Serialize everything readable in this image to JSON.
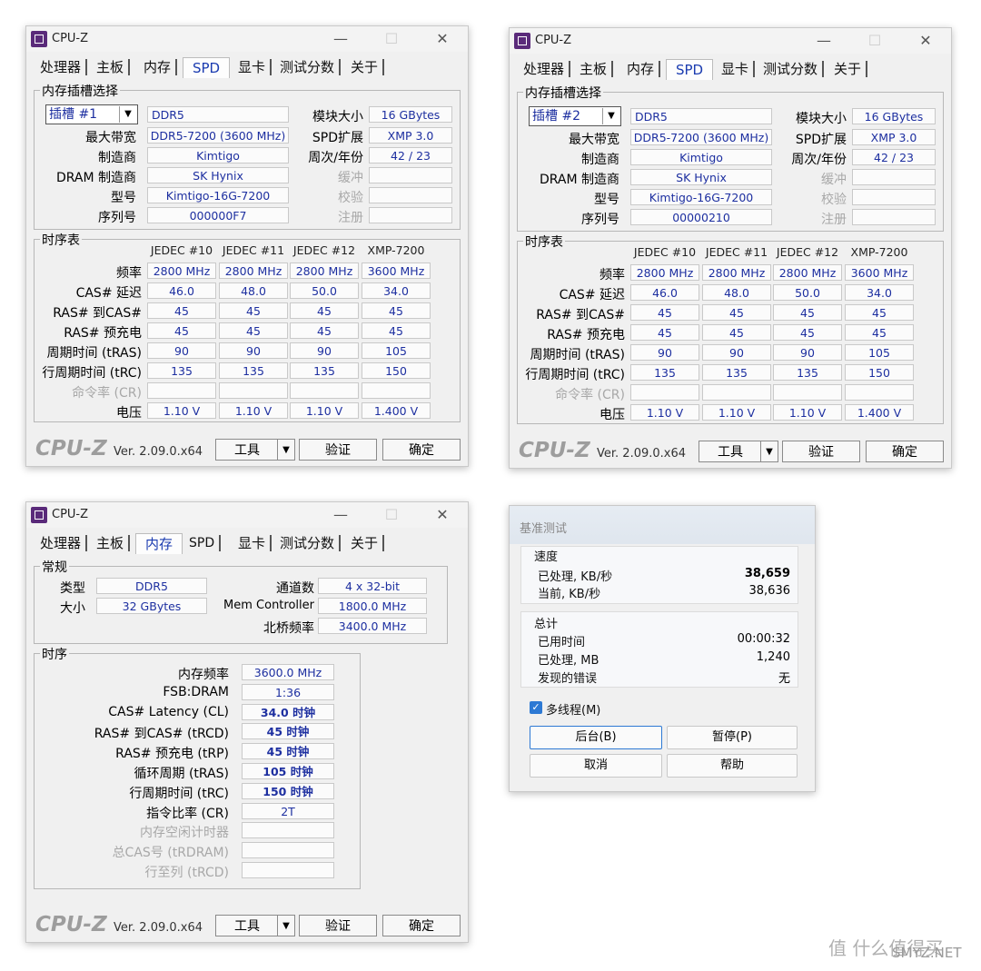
{
  "app_title": "CPU-Z",
  "tabs": [
    "处理器",
    "主板",
    "内存",
    "SPD",
    "显卡",
    "测试分数",
    "关于"
  ],
  "footer": {
    "logo": "CPU-Z",
    "version": "Ver. 2.09.0.x64",
    "tools": "工具",
    "validate": "验证",
    "ok": "确定"
  },
  "spd_labels": {
    "slot_group": "内存插槽选择",
    "max_bw": "最大带宽",
    "manufacturer": "制造商",
    "dram_mfr": "DRAM 制造商",
    "part": "型号",
    "serial": "序列号",
    "module_size": "模块大小",
    "spd_ext": "SPD扩展",
    "week_year": "周次/年份",
    "buffered": "缓冲",
    "corrected": "校验",
    "registered": "注册",
    "timing_group": "时序表",
    "row_labels": [
      "频率",
      "CAS# 延迟",
      "RAS# 到CAS#",
      "RAS# 预充电",
      "周期时间 (tRAS)",
      "行周期时间 (tRC)",
      "命令率 (CR)",
      "电压"
    ]
  },
  "spd_windows": [
    {
      "slot": "插槽 #1",
      "type": "DDR5",
      "max_bw": "DDR5-7200 (3600 MHz)",
      "manufacturer": "Kimtigo",
      "dram_mfr": "SK Hynix",
      "part": "Kimtigo-16G-7200",
      "serial": "000000F7",
      "module_size": "16 GBytes",
      "spd_ext": "XMP 3.0",
      "week_year": "42 / 23",
      "columns": [
        "JEDEC #10",
        "JEDEC #11",
        "JEDEC #12",
        "XMP-7200"
      ],
      "rows": [
        [
          "2800 MHz",
          "2800 MHz",
          "2800 MHz",
          "3600 MHz"
        ],
        [
          "46.0",
          "48.0",
          "50.0",
          "34.0"
        ],
        [
          "45",
          "45",
          "45",
          "45"
        ],
        [
          "45",
          "45",
          "45",
          "45"
        ],
        [
          "90",
          "90",
          "90",
          "105"
        ],
        [
          "135",
          "135",
          "135",
          "150"
        ],
        [
          "",
          "",
          "",
          ""
        ],
        [
          "1.10 V",
          "1.10 V",
          "1.10 V",
          "1.400 V"
        ]
      ]
    },
    {
      "slot": "插槽 #2",
      "type": "DDR5",
      "max_bw": "DDR5-7200 (3600 MHz)",
      "manufacturer": "Kimtigo",
      "dram_mfr": "SK Hynix",
      "part": "Kimtigo-16G-7200",
      "serial": "00000210",
      "module_size": "16 GBytes",
      "spd_ext": "XMP 3.0",
      "week_year": "42 / 23",
      "columns": [
        "JEDEC #10",
        "JEDEC #11",
        "JEDEC #12",
        "XMP-7200"
      ],
      "rows": [
        [
          "2800 MHz",
          "2800 MHz",
          "2800 MHz",
          "3600 MHz"
        ],
        [
          "46.0",
          "48.0",
          "50.0",
          "34.0"
        ],
        [
          "45",
          "45",
          "45",
          "45"
        ],
        [
          "45",
          "45",
          "45",
          "45"
        ],
        [
          "90",
          "90",
          "90",
          "105"
        ],
        [
          "135",
          "135",
          "135",
          "150"
        ],
        [
          "",
          "",
          "",
          ""
        ],
        [
          "1.10 V",
          "1.10 V",
          "1.10 V",
          "1.400 V"
        ]
      ]
    }
  ],
  "memory": {
    "general_group": "常规",
    "type_label": "类型",
    "type": "DDR5",
    "size_label": "大小",
    "size": "32 GBytes",
    "channels_label": "通道数",
    "channels": "4 x 32-bit",
    "mc_label": "Mem Controller",
    "mc": "1800.0 MHz",
    "nb_label": "北桥频率",
    "nb": "3400.0 MHz",
    "timing_group": "时序",
    "timings": [
      {
        "label": "内存频率",
        "value": "3600.0 MHz"
      },
      {
        "label": "FSB:DRAM",
        "value": "1:36"
      },
      {
        "label": "CAS# Latency (CL)",
        "value": "34.0 时钟"
      },
      {
        "label": "RAS# 到CAS# (tRCD)",
        "value": "45 时钟"
      },
      {
        "label": "RAS# 预充电 (tRP)",
        "value": "45 时钟"
      },
      {
        "label": "循环周期 (tRAS)",
        "value": "105 时钟"
      },
      {
        "label": "行周期时间 (tRC)",
        "value": "150 时钟"
      },
      {
        "label": "指令比率 (CR)",
        "value": "2T"
      },
      {
        "label": "内存空闲计时器",
        "value": ""
      },
      {
        "label": "总CAS号 (tRDRAM)",
        "value": ""
      },
      {
        "label": "行至列 (tRCD)",
        "value": ""
      }
    ]
  },
  "benchmark": {
    "title": "基准测试",
    "speed_group": "速度",
    "processed_kbs_label": "已处理, KB/秒",
    "processed_kbs": "38,659",
    "current_kbs_label": "当前, KB/秒",
    "current_kbs": "38,636",
    "total_group": "总计",
    "elapsed_label": "已用时间",
    "elapsed": "00:00:32",
    "processed_mb_label": "已处理, MB",
    "processed_mb": "1,240",
    "errors_label": "发现的错误",
    "errors": "无",
    "multithread": "多线程(M)",
    "background": "后台(B)",
    "pause": "暂停(P)",
    "cancel": "取消",
    "help": "帮助"
  },
  "watermark": "值 什么值得买",
  "watermark2": "SMYZ.NET"
}
